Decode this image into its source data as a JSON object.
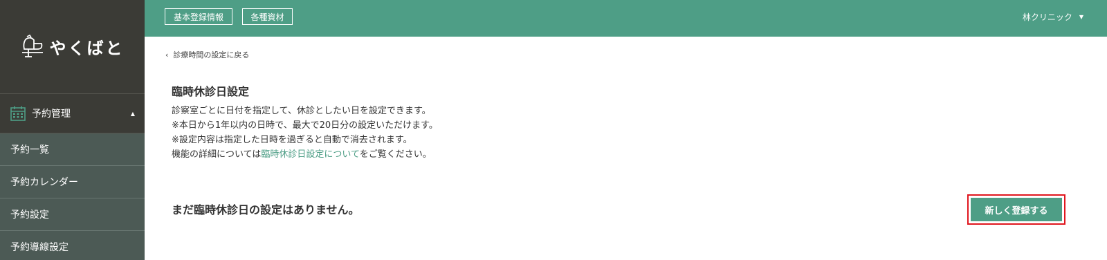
{
  "app": {
    "logo_text": "やくばと"
  },
  "sidebar": {
    "section": {
      "label": "予約管理"
    },
    "items": [
      {
        "label": "予約一覧"
      },
      {
        "label": "予約カレンダー"
      },
      {
        "label": "予約設定"
      },
      {
        "label": "予約導線設定"
      }
    ]
  },
  "topbar": {
    "buttons": [
      {
        "label": "基本登録情報"
      },
      {
        "label": "各種資材"
      }
    ],
    "clinic_name": "林クリニック"
  },
  "main": {
    "back_link": "診療時間の設定に戻る",
    "title": "臨時休診日設定",
    "desc_line1": "診察室ごとに日付を指定して、休診としたい日を設定できます。",
    "desc_line2": "※本日から1年以内の日時で、最大で20日分の設定いただけます。",
    "desc_line3": "※設定内容は指定した日時を過ぎると自動で消去されます。",
    "desc_line4_pre": "機能の詳細については",
    "desc_line4_link": "臨時休診日設定について",
    "desc_line4_post": "をご覧ください。",
    "empty_message": "まだ臨時休診日の設定はありません。",
    "register_button": "新しく登録する"
  },
  "colors": {
    "accent": "#4e9e86",
    "sidebar_bg": "#3b3b36",
    "submenu_bg": "#4c5a55",
    "highlight": "#e0161e"
  }
}
